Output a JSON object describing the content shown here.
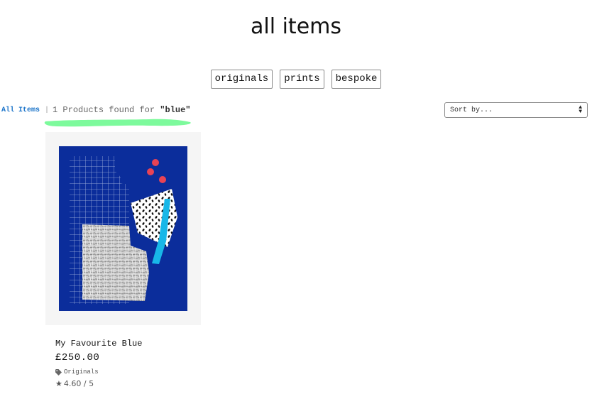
{
  "page": {
    "title": "all items"
  },
  "categories": [
    {
      "label": "originals"
    },
    {
      "label": "prints"
    },
    {
      "label": "bespoke"
    }
  ],
  "breadcrumb": {
    "link_label": "All Items",
    "separator": "|"
  },
  "results": {
    "prefix": "1 Products found for ",
    "query": "\"blue\""
  },
  "sort": {
    "selected": "Sort by..."
  },
  "colors": {
    "highlight": "#7dfa9c",
    "link": "#1a73c9",
    "artwork_blue": "#0b2d9b"
  },
  "products": [
    {
      "name": "My Favourite Blue",
      "price": "£250.00",
      "category": "Originals",
      "category_icon": "tag-icon",
      "rating": "4.60 / 5",
      "rating_icon": "star-icon"
    }
  ]
}
